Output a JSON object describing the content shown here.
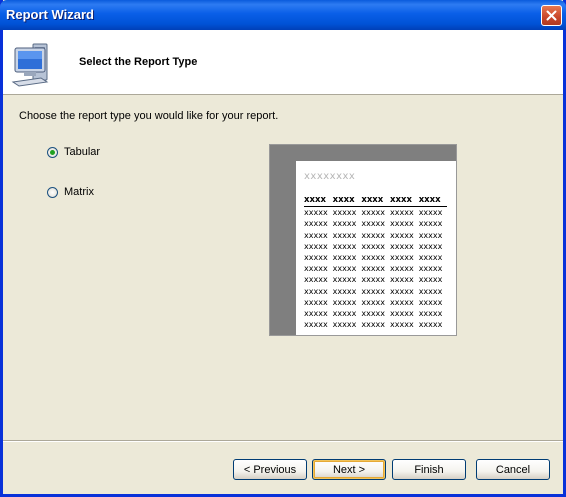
{
  "window": {
    "title": "Report Wizard"
  },
  "header": {
    "title": "Select the Report Type",
    "icon": "computer-monitor-icon"
  },
  "main": {
    "instruction": "Choose the report type you would like for your report.",
    "options": [
      {
        "label": "Tabular",
        "selected": true
      },
      {
        "label": "Matrix",
        "selected": false
      }
    ]
  },
  "preview": {
    "title": "xxxxxxxx",
    "headers": [
      "xxxx",
      "xxxx",
      "xxxx",
      "xxxx",
      "xxxx"
    ],
    "rows": [
      [
        "xxxxx",
        "xxxxx",
        "xxxxx",
        "xxxxx",
        "xxxxx"
      ],
      [
        "xxxxx",
        "xxxxx",
        "xxxxx",
        "xxxxx",
        "xxxxx"
      ],
      [
        "xxxxx",
        "xxxxx",
        "xxxxx",
        "xxxxx",
        "xxxxx"
      ],
      [
        "xxxxx",
        "xxxxx",
        "xxxxx",
        "xxxxx",
        "xxxxx"
      ],
      [
        "xxxxx",
        "xxxxx",
        "xxxxx",
        "xxxxx",
        "xxxxx"
      ],
      [
        "xxxxx",
        "xxxxx",
        "xxxxx",
        "xxxxx",
        "xxxxx"
      ],
      [
        "xxxxx",
        "xxxxx",
        "xxxxx",
        "xxxxx",
        "xxxxx"
      ],
      [
        "xxxxx",
        "xxxxx",
        "xxxxx",
        "xxxxx",
        "xxxxx"
      ],
      [
        "xxxxx",
        "xxxxx",
        "xxxxx",
        "xxxxx",
        "xxxxx"
      ],
      [
        "xxxxx",
        "xxxxx",
        "xxxxx",
        "xxxxx",
        "xxxxx"
      ],
      [
        "xxxxx",
        "xxxxx",
        "xxxxx",
        "xxxxx",
        "xxxxx"
      ]
    ]
  },
  "buttons": {
    "previous": "< Previous",
    "next": "Next >",
    "finish": "Finish",
    "cancel": "Cancel"
  },
  "colors": {
    "titlebar": "#0a5fe8",
    "dialog_bg": "#ece9d8",
    "close_button": "#c8462a",
    "radio_selected": "#21a121"
  }
}
